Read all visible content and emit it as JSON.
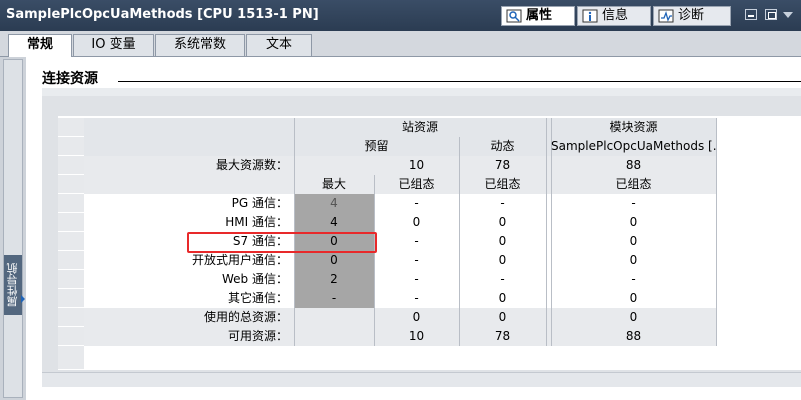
{
  "window": {
    "title": "SamplePlcOpcUaMethods [CPU 1513-1 PN]",
    "top_tabs": [
      {
        "label": "属性",
        "icon": "properties-icon",
        "active": true
      },
      {
        "label": "信息",
        "icon": "info-icon",
        "active": false
      },
      {
        "label": "诊断",
        "icon": "diagnostics-icon",
        "active": false
      }
    ]
  },
  "tabs": [
    "常规",
    "IO 变量",
    "系统常数",
    "文本"
  ],
  "sidebar": {
    "vertical_label": "属性导航"
  },
  "section": {
    "title": "连接资源"
  },
  "table": {
    "group_headers": {
      "station": "站资源",
      "module": "模块资源"
    },
    "sub_headers": {
      "reserved": "预留",
      "dynamic": "动态",
      "module_name": "SamplePlcOpcUaMethods [..."
    },
    "max_row": {
      "label": "最大资源数：",
      "reserved": "10",
      "dynamic": "78",
      "module": "88"
    },
    "col_headers": {
      "max": "最大",
      "configured": "已组态",
      "dyn_configured": "已组态",
      "mod_configured": "已组态"
    },
    "rows": [
      {
        "label": "PG 通信：",
        "max": "4",
        "configured": "-",
        "dynamic": "-",
        "module": "-"
      },
      {
        "label": "HMI 通信：",
        "max": "4",
        "configured": "0",
        "dynamic": "0",
        "module": "0"
      },
      {
        "label": "S7 通信：",
        "max": "0",
        "configured": "-",
        "dynamic": "0",
        "module": "0"
      },
      {
        "label": "开放式用户通信：",
        "max": "0",
        "configured": "-",
        "dynamic": "0",
        "module": "0"
      },
      {
        "label": "Web 通信：",
        "max": "2",
        "configured": "-",
        "dynamic": "-",
        "module": "-"
      },
      {
        "label": "其它通信：",
        "max": "-",
        "configured": "-",
        "dynamic": "0",
        "module": "0"
      }
    ],
    "used_row": {
      "label": "使用的总资源：",
      "configured": "0",
      "dynamic": "0",
      "module": "0"
    },
    "available_row": {
      "label": "可用资源：",
      "configured": "10",
      "dynamic": "78",
      "module": "88"
    }
  },
  "colors": {
    "titlebar": "#2b3c52",
    "highlight_box": "#e8292a",
    "max_column_fill": "#a6a6a6"
  }
}
